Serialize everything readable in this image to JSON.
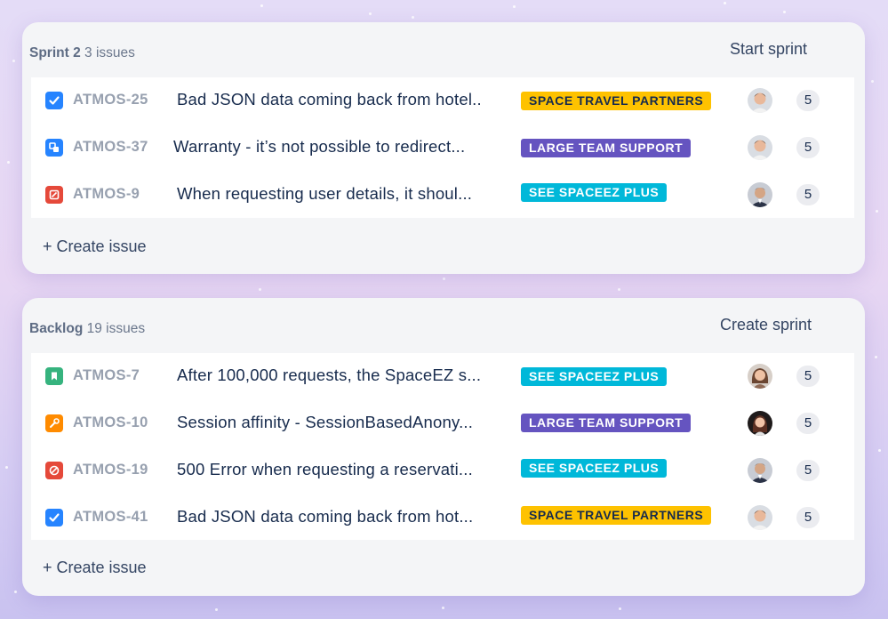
{
  "sprint": {
    "name": "Sprint 2",
    "count": "3 issues",
    "action": "Start sprint",
    "create_label": "+ Create issue",
    "issues": [
      {
        "type": "story-done",
        "key": "ATMOS-25",
        "summary": "Bad JSON data coming back from hotel..",
        "epic": "SPACE TRAVEL PARTNERS",
        "epic_color": "#fec200",
        "assignee": "avatar-man-1",
        "points": "5"
      },
      {
        "type": "subtask",
        "key": "ATMOS-37",
        "summary": "Warranty - it’s not possible to redirect...",
        "epic": "LARGE TEAM SUPPORT",
        "epic_color": "#6554c0",
        "assignee": "avatar-man-1",
        "points": "5"
      },
      {
        "type": "bug",
        "key": "ATMOS-9",
        "summary": "When requesting user details, it shoul...",
        "epic": "SEE SPACEEZ PLUS",
        "epic_color": "#00b8d9",
        "assignee": "avatar-man-2",
        "points": "5"
      }
    ]
  },
  "backlog": {
    "name": "Backlog",
    "count": "19 issues",
    "action": "Create sprint",
    "create_label": "+ Create issue",
    "issues": [
      {
        "type": "story",
        "key": "ATMOS-7",
        "summary": "After 100,000 requests, the SpaceEZ s...",
        "epic": "SEE SPACEEZ PLUS",
        "epic_color": "#00b8d9",
        "assignee": "avatar-woman-1",
        "points": "5"
      },
      {
        "type": "improvement",
        "key": "ATMOS-10",
        "summary": "Session affinity - SessionBasedAnony...",
        "epic": "LARGE TEAM SUPPORT",
        "epic_color": "#6554c0",
        "assignee": "avatar-woman-2",
        "points": "5"
      },
      {
        "type": "blocker",
        "key": "ATMOS-19",
        "summary": "500 Error when requesting a reservati...",
        "epic": "SEE SPACEEZ PLUS",
        "epic_color": "#00b8d9",
        "assignee": "avatar-man-2",
        "points": "5"
      },
      {
        "type": "story-done",
        "key": "ATMOS-41",
        "summary": "Bad JSON data coming back from hot...",
        "epic": "SPACE TRAVEL PARTNERS",
        "epic_color": "#fec200",
        "assignee": "avatar-man-1",
        "points": "5"
      }
    ]
  },
  "colors": {
    "task": "#2684ff",
    "bug": "#e5493a",
    "story": "#36b37e",
    "improvement": "#ff8b00",
    "epic_yellow": "#fec200",
    "epic_purple": "#6554c0",
    "epic_cyan": "#00b8d9"
  }
}
